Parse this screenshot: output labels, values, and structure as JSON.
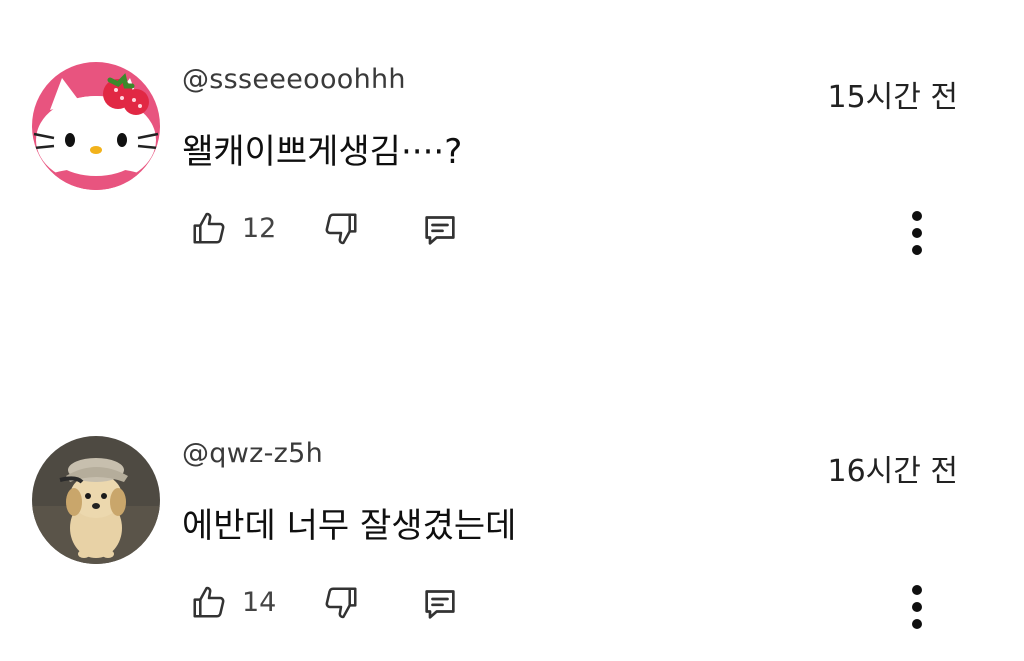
{
  "comments": [
    {
      "username": "@ssseeeooohhh",
      "timestamp": "15시간 전",
      "text": "왤캐이쁘게생김····?",
      "like_count": "12",
      "avatar": "hello-kitty-avatar"
    },
    {
      "username": "@qwz-z5h",
      "timestamp": "16시간 전",
      "text": "에반데 너무 잘생겼는데",
      "like_count": "14",
      "avatar": "puppy-with-hat-avatar"
    }
  ],
  "icons": {
    "like": "thumbs-up-icon",
    "dislike": "thumbs-down-icon",
    "reply": "comment-icon",
    "more": "more-vertical-icon"
  },
  "colors": {
    "text": "#0f0f0f",
    "secondary_text": "#3a3a3a",
    "icon": "#333333",
    "avatar1_bg": "#e8547f",
    "avatar2_bg": "#4e4a42"
  }
}
